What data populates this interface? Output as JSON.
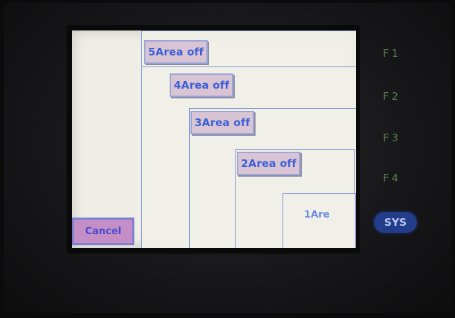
{
  "device": {
    "function_keys": [
      "F1",
      "F2",
      "F3",
      "F4"
    ],
    "sys_label": "SYS"
  },
  "screen": {
    "areas": [
      {
        "button": "5Area off"
      },
      {
        "button": "4Area off"
      },
      {
        "button": "3Area off"
      },
      {
        "button": "2Area off"
      },
      {
        "label": "1Are"
      }
    ],
    "cancel_label": "Cancel"
  },
  "colors": {
    "screen_bg": "#efeee6",
    "area_border": "#7d92d0",
    "button_bg": "#d9c4d4",
    "button_text": "#3b5fd8",
    "sys_key": "#223d8a"
  }
}
